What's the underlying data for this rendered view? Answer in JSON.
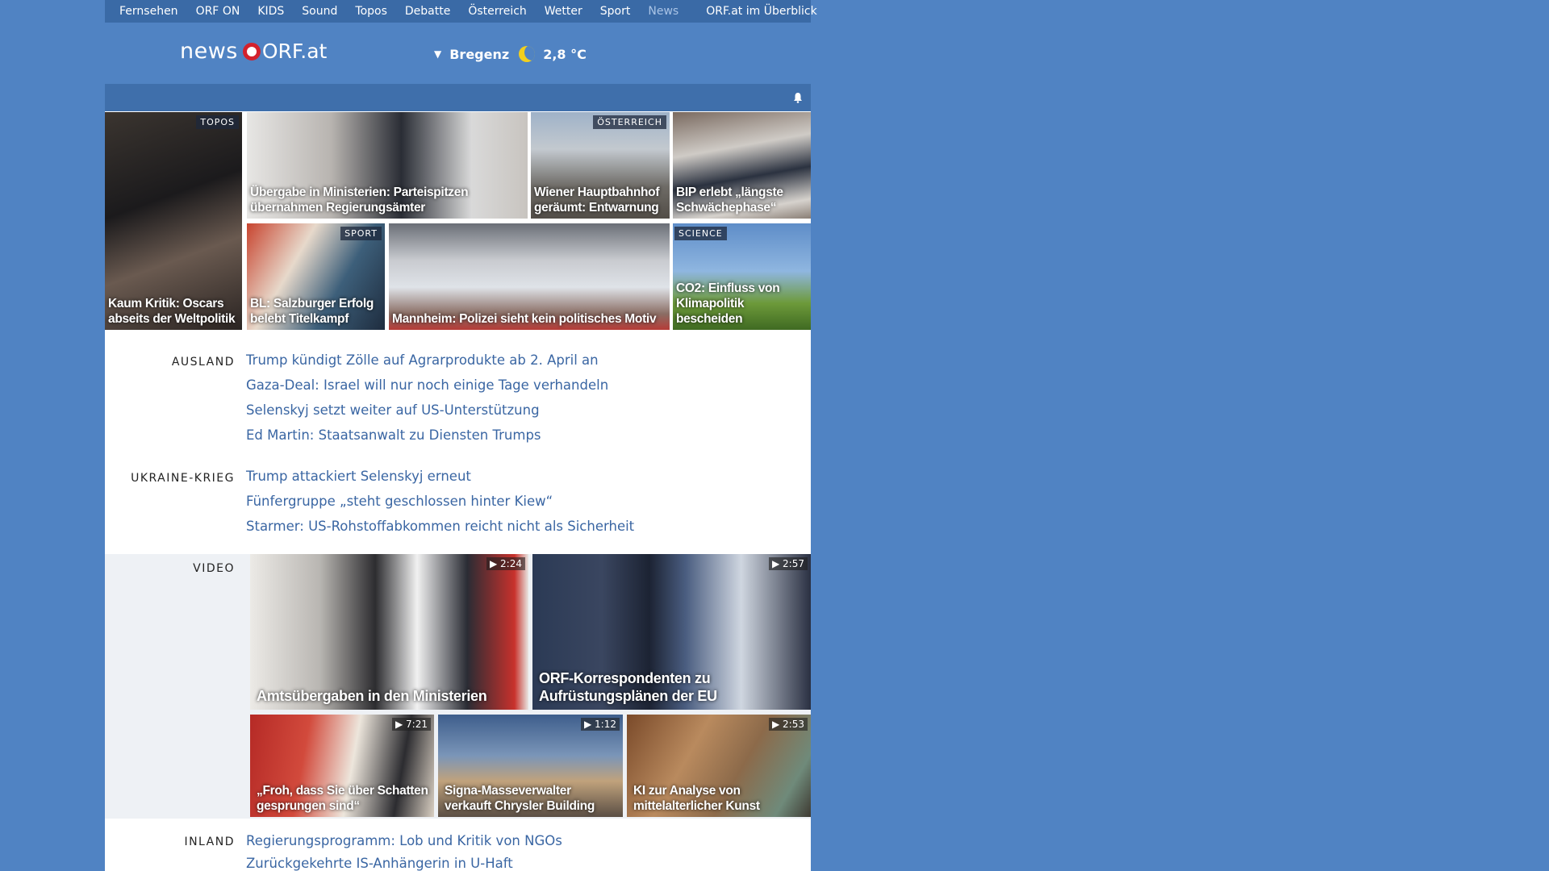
{
  "topnav": {
    "items": [
      "Fernsehen",
      "ORF ON",
      "KIDS",
      "Sound",
      "Topos",
      "Debatte",
      "Österreich",
      "Wetter",
      "Sport",
      "News"
    ],
    "active": "News",
    "overview": "ORF.at im Überblick"
  },
  "logo": {
    "news": "news",
    "orf": "ORF.at"
  },
  "weather": {
    "city": "Bregenz",
    "temp": "2,8 °C",
    "icon": "moon-icon"
  },
  "tiles": [
    {
      "title": "Kaum Kritik: Oscars abseits der Weltpolitik",
      "tag": "TOPOS"
    },
    {
      "title": "Übergabe in Ministerien: Parteispitzen übernahmen Regierungsämter",
      "tag": ""
    },
    {
      "title": "Wiener Hauptbahnhof geräumt: Entwarnung",
      "tag": "ÖSTERREICH"
    },
    {
      "title": "BIP erlebt „längste Schwächephase“",
      "tag": ""
    },
    {
      "title": "BL: Salzburger Erfolg belebt Titelkampf",
      "tag": "SPORT"
    },
    {
      "title": "Mannheim: Polizei sieht kein politisches Motiv",
      "tag": ""
    },
    {
      "title": "CO2: Einfluss von Klimapolitik bescheiden",
      "tag": "SCIENCE"
    }
  ],
  "ausland": {
    "label": "AUSLAND",
    "links": [
      "Trump kündigt Zölle auf Agrarprodukte ab 2. April an",
      "Gaza-Deal: Israel will nur noch einige Tage verhandeln",
      "Selenskyj setzt weiter auf US-Unterstützung",
      "Ed Martin: Staatsanwalt zu Diensten Trumps"
    ]
  },
  "ukraine": {
    "label": "UKRAINE-KRIEG",
    "links": [
      "Trump attackiert Selenskyj erneut",
      "Fünfergruppe „steht geschlossen hinter Kiew“",
      "Starmer: US-Rohstoffabkommen reicht nicht als Sicherheit"
    ]
  },
  "video": {
    "label": "VIDEO",
    "items": [
      {
        "title": "Amtsübergaben in den Ministerien",
        "duration": "▶ 2:24"
      },
      {
        "title": "ORF-Korrespondenten zu Aufrüstungsplänen der EU",
        "duration": "▶ 2:57"
      },
      {
        "title": "„Froh, dass Sie über Schatten gesprungen sind“",
        "duration": "▶ 7:21"
      },
      {
        "title": "Signa-Masseverwalter verkauft Chrysler Building",
        "duration": "▶ 1:12"
      },
      {
        "title": "KI zur Analyse von mittelalterlicher Kunst",
        "duration": "▶ 2:53"
      }
    ]
  },
  "inland": {
    "label": "INLAND",
    "links": [
      "Regierungsprogramm: Lob und Kritik von NGOs",
      "Zurückgekehrte IS-Anhängerin in U-Haft"
    ]
  }
}
